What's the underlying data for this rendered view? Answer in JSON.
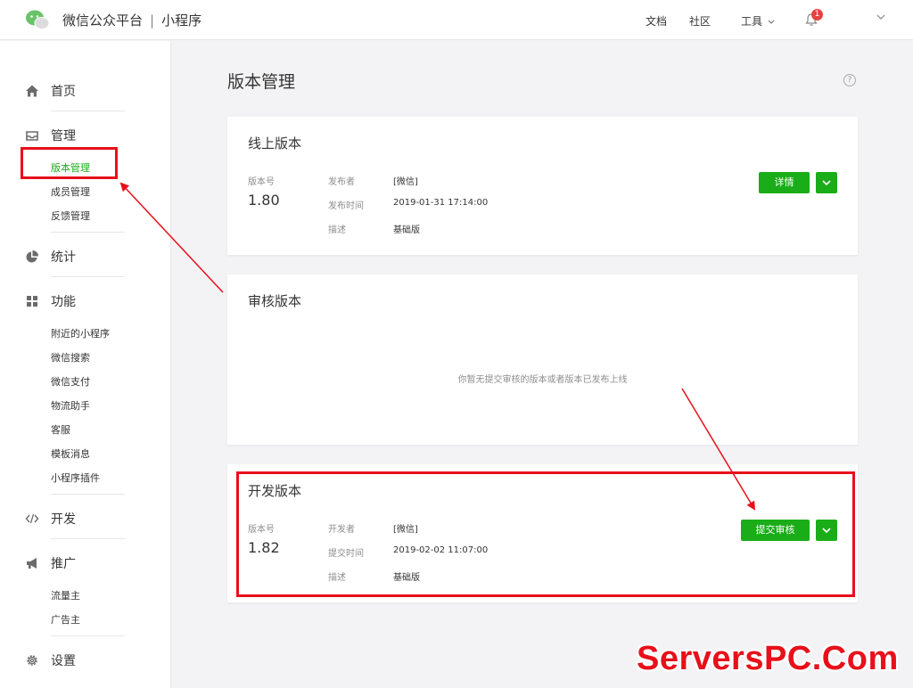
{
  "header": {
    "brand": "微信公众平台",
    "separator": "|",
    "product": "小程序",
    "nav": {
      "docs": "文档",
      "community": "社区",
      "tools": "工具"
    },
    "notification_count": "1"
  },
  "sidebar": {
    "home": "首页",
    "manage": "管理",
    "manage_items": [
      "版本管理",
      "成员管理",
      "反馈管理"
    ],
    "stats": "统计",
    "features": "功能",
    "feature_items": [
      "附近的小程序",
      "微信搜索",
      "微信支付",
      "物流助手",
      "客服",
      "模板消息",
      "小程序插件"
    ],
    "dev": "开发",
    "promote": "推广",
    "promote_items": [
      "流量主",
      "广告主"
    ],
    "settings": "设置"
  },
  "main": {
    "title": "版本管理",
    "help": "?",
    "online": {
      "title": "线上版本",
      "version_label": "版本号",
      "version": "1.80",
      "publisher_label": "发布者",
      "publisher": "[微信]",
      "time_label": "发布时间",
      "time": "2019-01-31 17:14:00",
      "desc_label": "描述",
      "desc": "基础版",
      "button": "详情"
    },
    "review": {
      "title": "审核版本",
      "empty": "你暂无提交审核的版本或者版本已发布上线"
    },
    "dev": {
      "title": "开发版本",
      "version_label": "版本号",
      "version": "1.82",
      "developer_label": "开发者",
      "developer": "[微信]",
      "time_label": "提交时间",
      "time": "2019-02-02 11:07:00",
      "desc_label": "描述",
      "desc": "基础版",
      "button": "提交审核"
    }
  },
  "watermark": "ServersPC.Com",
  "colors": {
    "accent": "#1aad19",
    "annotation": "#e8101a"
  }
}
